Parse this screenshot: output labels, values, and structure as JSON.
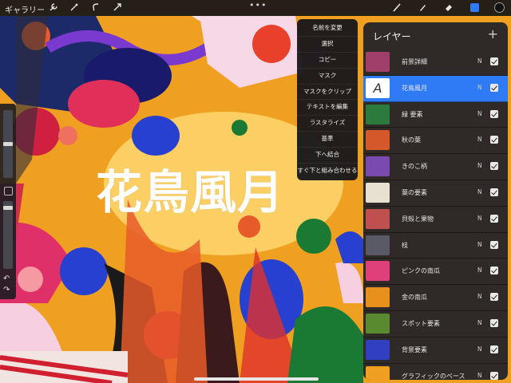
{
  "topbar": {
    "gallery_label": "ギャラリー",
    "tools": [
      {
        "icon": "wrench-icon"
      },
      {
        "icon": "adjustments-icon"
      },
      {
        "icon": "selection-icon"
      },
      {
        "icon": "transform-arrow-icon"
      }
    ],
    "more_label": "•••",
    "right_tools": [
      {
        "icon": "brush-icon"
      },
      {
        "icon": "smudge-icon"
      },
      {
        "icon": "eraser-icon"
      },
      {
        "icon": "layers-icon"
      },
      {
        "icon": "color-icon"
      }
    ]
  },
  "canvas": {
    "text": "花鳥風月"
  },
  "context_menu": {
    "items": [
      "名前を変更",
      "選択",
      "コピー",
      "マスク",
      "マスクをクリップ",
      "テキストを編集",
      "ラスタライズ",
      "基準",
      "下へ結合",
      "すぐ下と組み合わせる"
    ]
  },
  "layers_panel": {
    "title": "レイヤー",
    "add_label": "+",
    "layers": [
      {
        "name": "前景詳細",
        "blend": "N",
        "selected": false,
        "thumb": "#a0406a"
      },
      {
        "name": "花鳥風月",
        "blend": "N",
        "selected": true,
        "thumb": "text"
      },
      {
        "name": "緑 要素",
        "blend": "N",
        "selected": false,
        "thumb": "#2c7a3c"
      },
      {
        "name": "秋の葉",
        "blend": "N",
        "selected": false,
        "thumb": "#d4582a"
      },
      {
        "name": "きのこ柄",
        "blend": "N",
        "selected": false,
        "thumb": "#7a4ab0"
      },
      {
        "name": "葉の要素",
        "blend": "N",
        "selected": false,
        "thumb": "#e8e0d0"
      },
      {
        "name": "貝殻と果物",
        "blend": "N",
        "selected": false,
        "thumb": "#c05050"
      },
      {
        "name": "枝",
        "blend": "N",
        "selected": false,
        "thumb": "#5a5a66"
      },
      {
        "name": "ピンクの南瓜",
        "blend": "N",
        "selected": false,
        "thumb": "#e0407a"
      },
      {
        "name": "金の南瓜",
        "blend": "N",
        "selected": false,
        "thumb": "#e8901c"
      },
      {
        "name": "スポット要素",
        "blend": "N",
        "selected": false,
        "thumb": "#5a8a30"
      },
      {
        "name": "背景要素",
        "blend": "N",
        "selected": false,
        "thumb": "#3040c0"
      },
      {
        "name": "グラフィックのベース",
        "blend": "N",
        "selected": false,
        "thumb": "#f0a020"
      }
    ]
  },
  "colors": {
    "accent": "#2f7bf5",
    "background": "#f0a020"
  }
}
